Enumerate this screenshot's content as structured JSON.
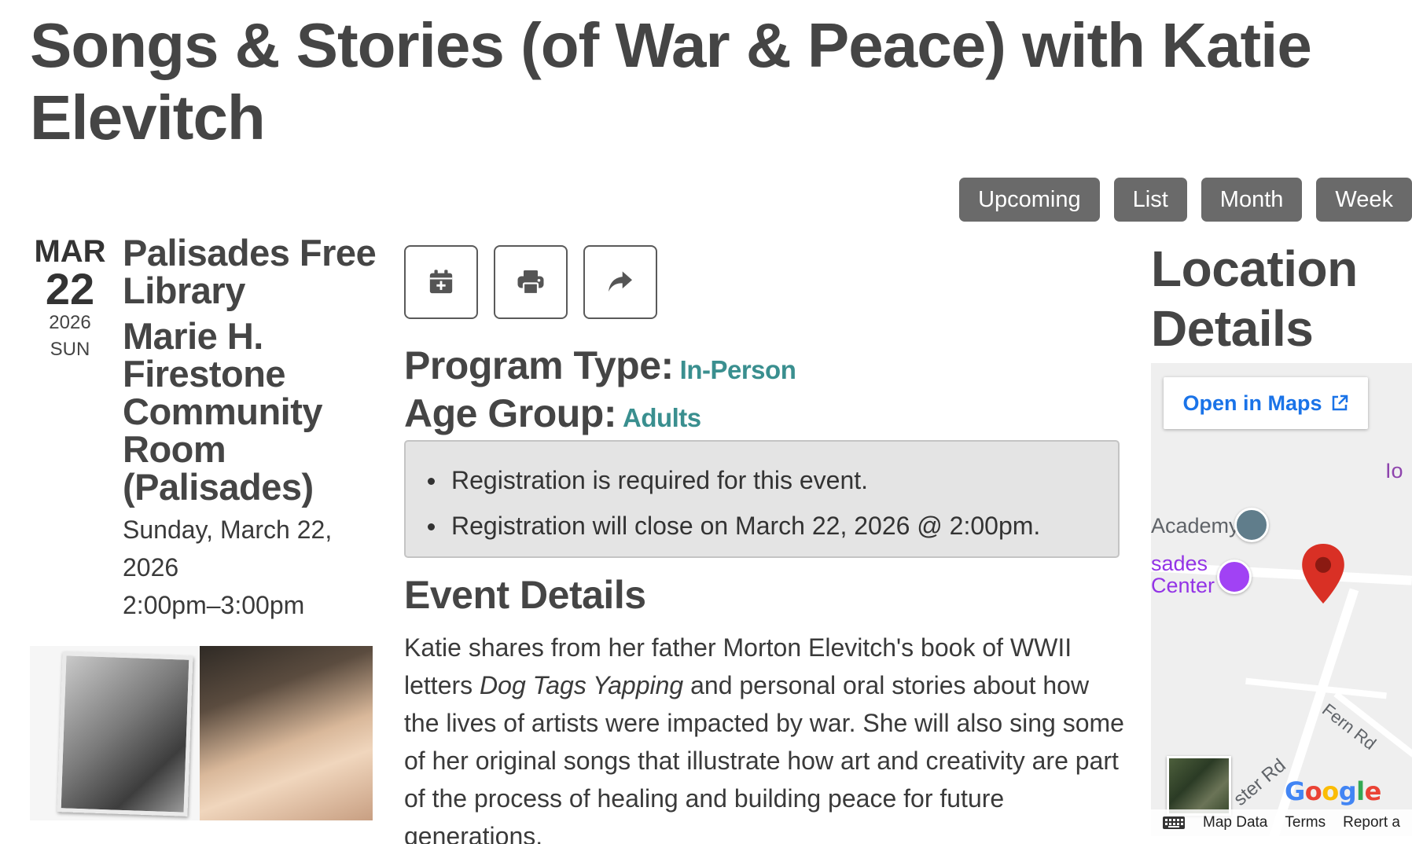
{
  "event": {
    "title": "Songs & Stories (of War & Peace) with Katie Elevitch",
    "date": {
      "month": "MAR",
      "day": "22",
      "year": "2026",
      "weekday": "SUN"
    },
    "branch": "Palisades Free Library",
    "room": "Marie H. Firestone Community Room (Palisades)",
    "full_date": "Sunday, March 22, 2026",
    "time": "2:00pm–3:00pm",
    "program_type_label": "Program Type:",
    "program_type_value": "In-Person",
    "age_group_label": "Age Group:",
    "age_group_value": "Adults",
    "registration": [
      "Registration is required for this event.",
      "Registration will close on March 22, 2026 @ 2:00pm."
    ],
    "details_heading": "Event Details",
    "details_body_1": "Katie shares from her father Morton Elevitch's book of WWII letters ",
    "details_book": "Dog Tags Yapping",
    "details_body_2": " and personal oral stories about how the lives of artists were impacted by war.  She will also sing some of her original songs that illustrate how art and creativity are part of the process of healing and building peace for future generations."
  },
  "views": [
    "Upcoming",
    "List",
    "Month",
    "Week"
  ],
  "actions": {
    "add_calendar": "calendar-plus-icon",
    "print": "printer-icon",
    "share": "share-icon"
  },
  "location": {
    "heading": "Location Details",
    "open_maps": "Open in Maps",
    "map_labels": {
      "academy": "Academy",
      "sades": "sades",
      "center": "Center",
      "io": "Io",
      "fern_rd": "Fern Rd",
      "ster_rd": "ster Rd"
    },
    "footer": {
      "map_data": "Map Data",
      "terms": "Terms",
      "report": "Report a"
    },
    "google": "Google"
  },
  "colors": {
    "accent": "#3a8f8f",
    "button_bg": "#6a6a6a",
    "map_link": "#1a73e8",
    "pin_red": "#d93025",
    "poi_purple": "#a142f4"
  }
}
